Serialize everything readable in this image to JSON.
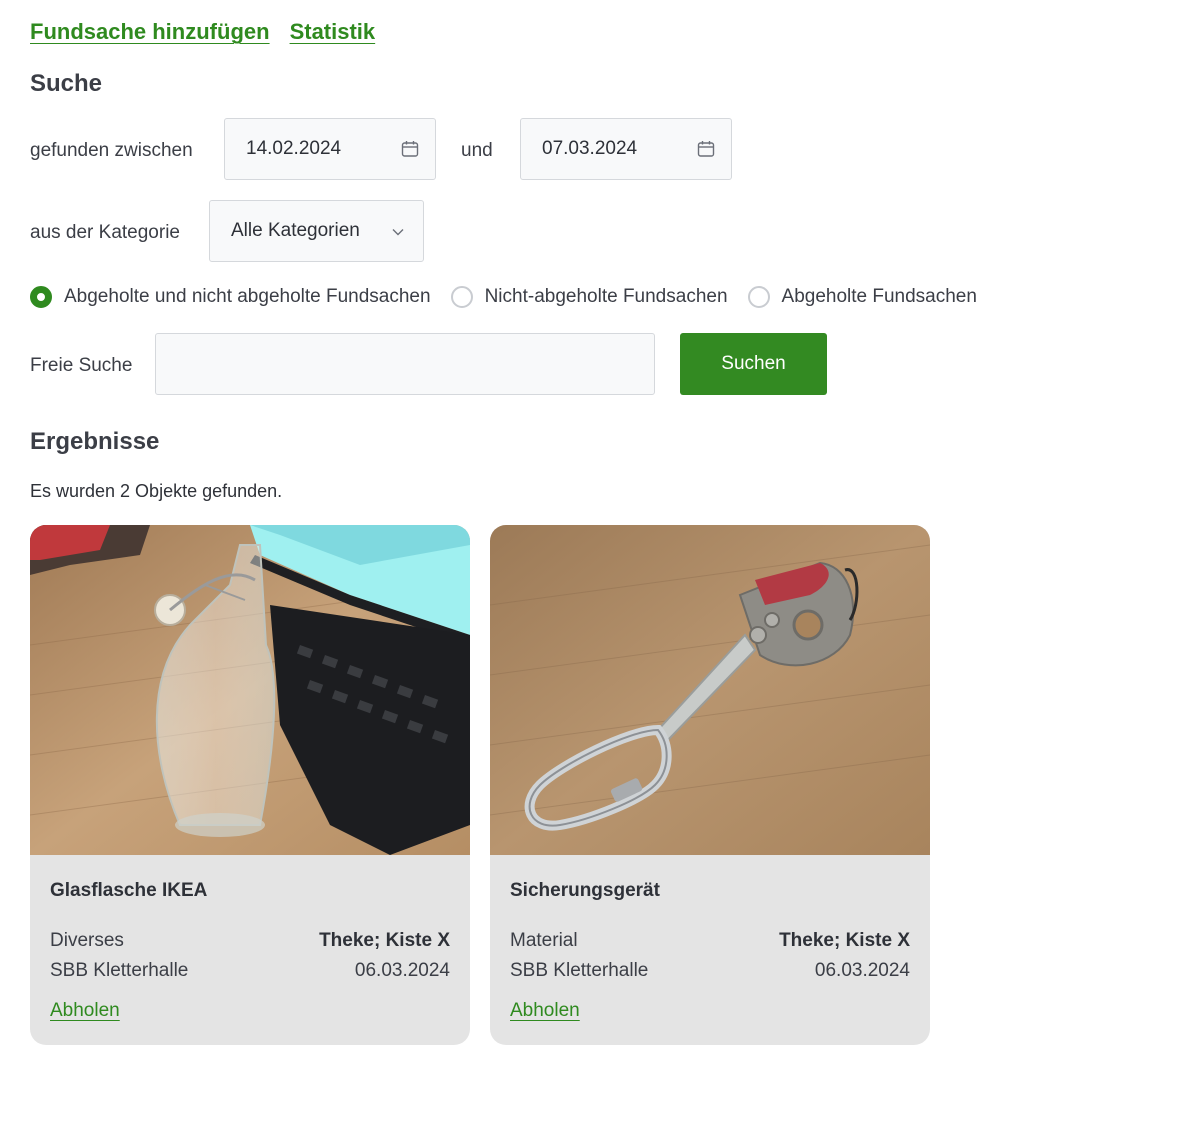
{
  "nav": {
    "add_item": "Fundsache hinzufügen",
    "statistics": "Statistik"
  },
  "search": {
    "heading": "Suche",
    "found_between_label": "gefunden zwischen",
    "date_from": "14.02.2024",
    "and_label": "und",
    "date_to": "07.03.2024",
    "category_label": "aus der Kategorie",
    "category_selected": "Alle Kategorien",
    "radio_options": [
      {
        "label": "Abgeholte und nicht abgeholte Fundsachen",
        "checked": true
      },
      {
        "label": "Nicht-abgeholte Fundsachen",
        "checked": false
      },
      {
        "label": "Abgeholte Fundsachen",
        "checked": false
      }
    ],
    "free_search_label": "Freie Suche",
    "free_search_value": "",
    "submit_label": "Suchen"
  },
  "results": {
    "heading": "Ergebnisse",
    "count_text": "Es wurden 2 Objekte gefunden.",
    "items": [
      {
        "title": "Glasflasche IKEA",
        "category": "Diverses",
        "storage": "Theke; Kiste X",
        "location": "SBB Kletterhalle",
        "date": "06.03.2024",
        "action": "Abholen"
      },
      {
        "title": "Sicherungsgerät",
        "category": "Material",
        "storage": "Theke; Kiste X",
        "location": "SBB Kletterhalle",
        "date": "06.03.2024",
        "action": "Abholen"
      }
    ]
  },
  "colors": {
    "accent": "#338a22",
    "card_bg": "#e4e4e4",
    "input_bg": "#f8f9fa"
  },
  "icons": {
    "calendar": "calendar-icon",
    "chevron": "chevron-down-icon"
  }
}
